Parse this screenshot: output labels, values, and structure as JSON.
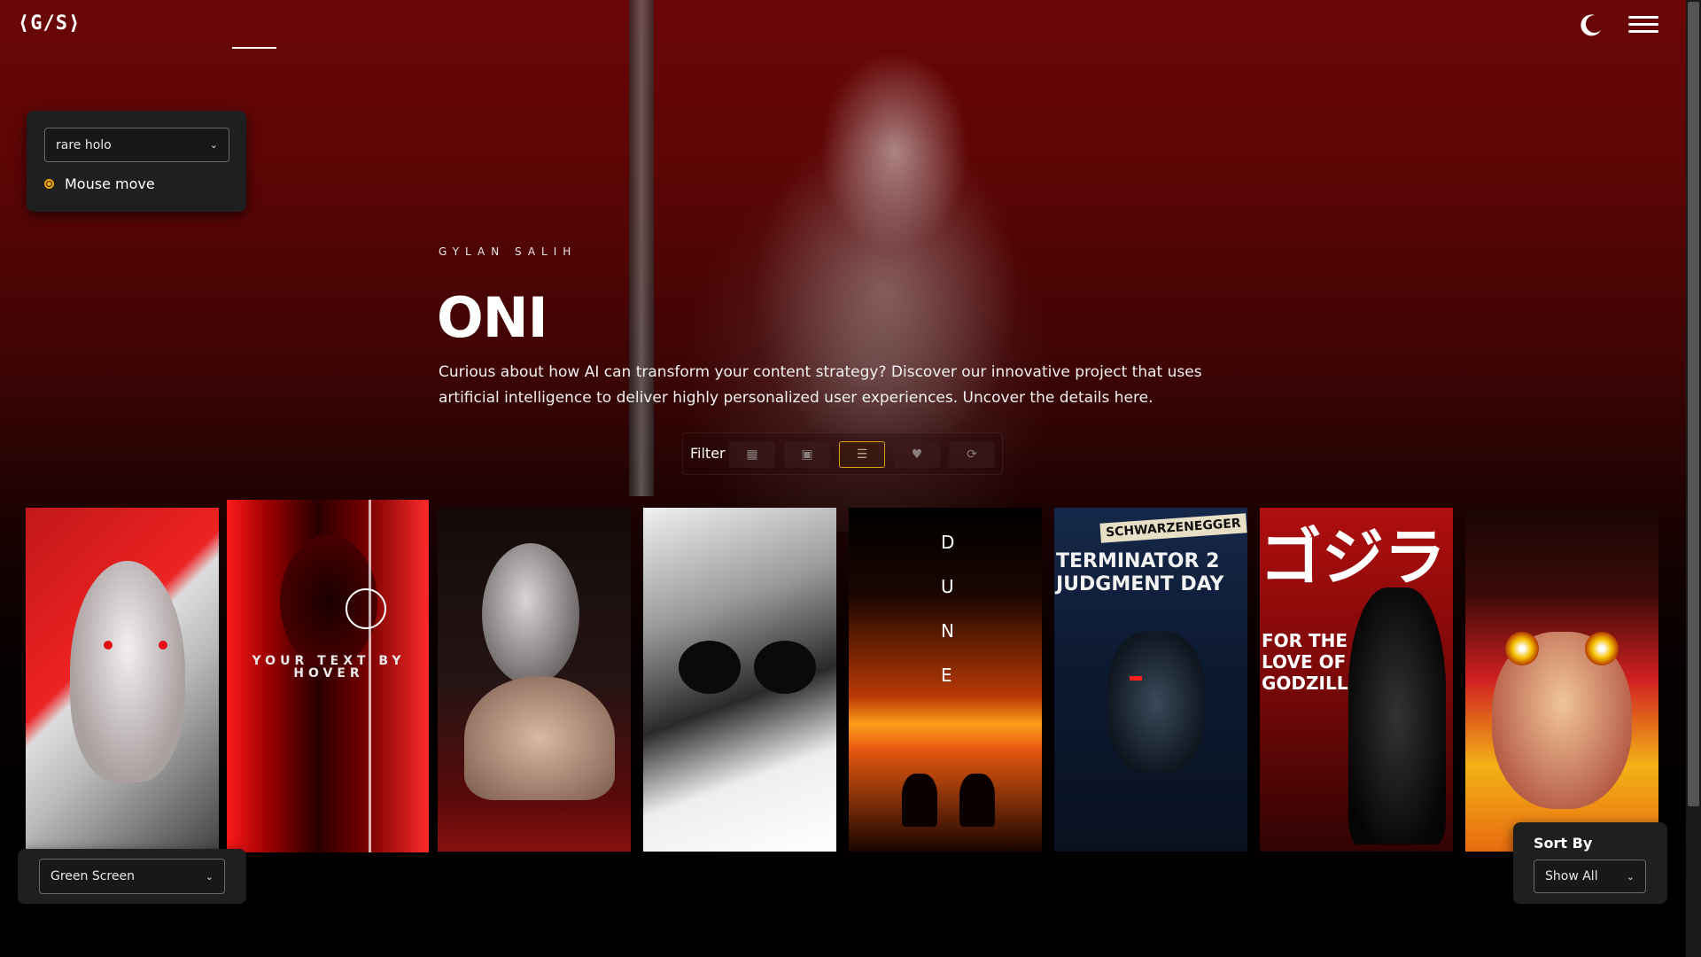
{
  "header": {
    "logo": "⟨G/S⟩",
    "theme_icon": "moon-icon",
    "menu_icon": "hamburger-menu-icon"
  },
  "effect_panel": {
    "select_value": "rare holo",
    "radio_label": "Mouse move"
  },
  "hero": {
    "author": "GYLAN SALIH",
    "title": "ONI",
    "description": "Curious about how AI can transform your content strategy? Discover our innovative project that uses artificial intelligence to deliver highly personalized user experiences. Uncover the details here."
  },
  "filter": {
    "label": "Filter",
    "buttons": [
      {
        "icon": "grid-large-icon",
        "glyph": "▦"
      },
      {
        "icon": "grid-small-icon",
        "glyph": "▣"
      },
      {
        "icon": "list-icon",
        "glyph": "☰"
      },
      {
        "icon": "heart-icon",
        "glyph": "♥"
      },
      {
        "icon": "refresh-icon",
        "glyph": "⟳"
      }
    ],
    "active_index": 2
  },
  "cards": [
    {
      "name": "white-hair-anime-card",
      "text": "",
      "bg": "#c21818"
    },
    {
      "name": "red-oni-hover-card",
      "text": "YOUR TEXT BY HOVER",
      "bg": "#d01010"
    },
    {
      "name": "horned-woman-card",
      "text": "",
      "bg": "#1a0d0d"
    },
    {
      "name": "sunglasses-manga-card",
      "text": "",
      "bg": "#888888"
    },
    {
      "name": "dune-poster-card",
      "text": "D U N E",
      "bg": "#e85a10"
    },
    {
      "name": "terminator-poster-card",
      "text": "TERMINATOR 2 JUDGMENT DAY",
      "top_text": "SCHWARZENEGGER",
      "bg": "#0f1e38"
    },
    {
      "name": "godzilla-poster-card",
      "text": "ゴジラ",
      "sub_text": "FOR THE LOVE OF GODZILLA",
      "bg": "#c21010"
    },
    {
      "name": "fire-eyes-anime-card",
      "text": "",
      "bg": "#e6a010"
    }
  ],
  "bottom_left": {
    "select_value": "Green Screen"
  },
  "sort": {
    "title": "Sort By",
    "select_value": "Show All"
  }
}
